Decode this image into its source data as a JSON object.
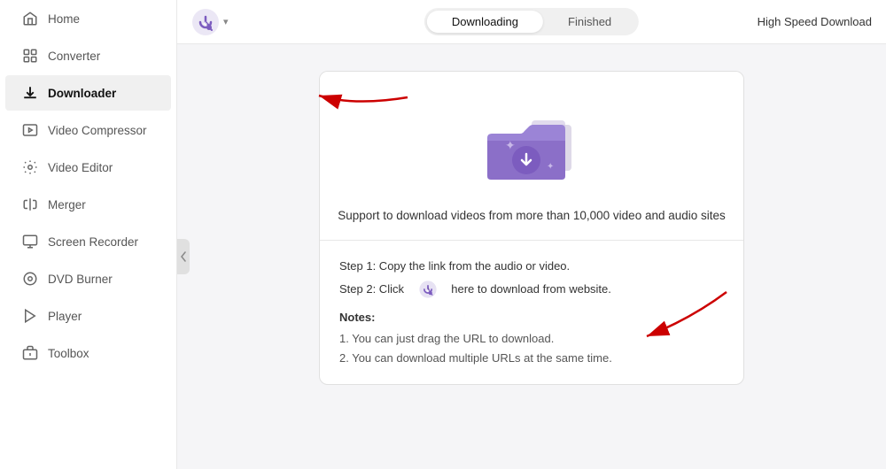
{
  "sidebar": {
    "items": [
      {
        "id": "home",
        "label": "Home",
        "icon": "home"
      },
      {
        "id": "converter",
        "label": "Converter",
        "icon": "converter"
      },
      {
        "id": "downloader",
        "label": "Downloader",
        "icon": "download",
        "active": true
      },
      {
        "id": "video-compressor",
        "label": "Video Compressor",
        "icon": "compress"
      },
      {
        "id": "video-editor",
        "label": "Video Editor",
        "icon": "edit"
      },
      {
        "id": "merger",
        "label": "Merger",
        "icon": "merge"
      },
      {
        "id": "screen-recorder",
        "label": "Screen Recorder",
        "icon": "record"
      },
      {
        "id": "dvd-burner",
        "label": "DVD Burner",
        "icon": "dvd"
      },
      {
        "id": "player",
        "label": "Player",
        "icon": "play"
      },
      {
        "id": "toolbox",
        "label": "Toolbox",
        "icon": "toolbox"
      }
    ]
  },
  "topbar": {
    "tabs": [
      {
        "id": "downloading",
        "label": "Downloading",
        "active": true
      },
      {
        "id": "finished",
        "label": "Finished",
        "active": false
      }
    ],
    "high_speed_label": "High Speed Download"
  },
  "main": {
    "card": {
      "subtitle": "Support to download videos from more than 10,000 video and audio sites",
      "step1": "Step 1: Copy the link from the audio or video.",
      "step2_prefix": "Step 2: Click",
      "step2_suffix": "here to download from website.",
      "notes_title": "Notes:",
      "note1": "1. You can just drag the URL to download.",
      "note2": "2. You can download multiple URLs at the same time."
    }
  }
}
